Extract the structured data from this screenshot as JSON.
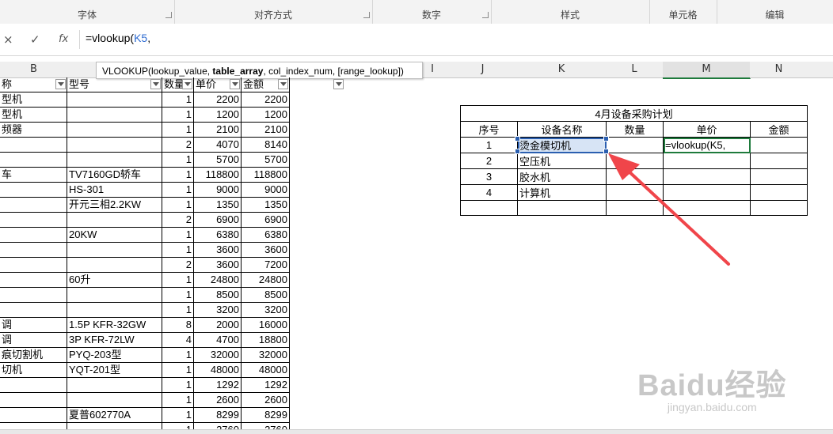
{
  "ribbon": {
    "groups": [
      "字体",
      "对齐方式",
      "数字",
      "样式",
      "单元格",
      "编辑"
    ]
  },
  "formula_bar": {
    "cancel_icon": "×",
    "enter_icon": "✓",
    "fx_icon": "fx",
    "formula_prefix": "=vlookup(",
    "formula_ref": "K5",
    "formula_suffix": ","
  },
  "tooltip": {
    "func": "VLOOKUP(lookup_value, ",
    "current_arg": "table_array",
    "rest": ", col_index_num, [range_lookup])"
  },
  "column_headers": {
    "B": "B",
    "I": "I",
    "J": "J",
    "K": "K",
    "L": "L",
    "M": "M",
    "N": "N"
  },
  "left_table": {
    "headers": [
      "称",
      "型号",
      "数量",
      "单价",
      "金额"
    ],
    "rows": [
      [
        "型机",
        "",
        "1",
        "2200",
        "2200"
      ],
      [
        "型机",
        "",
        "1",
        "1200",
        "1200"
      ],
      [
        "频器",
        "",
        "1",
        "2100",
        "2100"
      ],
      [
        "",
        "",
        "2",
        "4070",
        "8140"
      ],
      [
        "",
        "",
        "1",
        "5700",
        "5700"
      ],
      [
        "车",
        "TV7160GD轿车",
        "1",
        "118800",
        "118800"
      ],
      [
        "",
        "HS-301",
        "1",
        "9000",
        "9000"
      ],
      [
        "",
        "开元三相2.2KW",
        "1",
        "1350",
        "1350"
      ],
      [
        "",
        "",
        "2",
        "6900",
        "6900"
      ],
      [
        "",
        "20KW",
        "1",
        "6380",
        "6380"
      ],
      [
        "",
        "",
        "1",
        "3600",
        "3600"
      ],
      [
        "",
        "",
        "2",
        "3600",
        "7200"
      ],
      [
        "",
        "60升",
        "1",
        "24800",
        "24800"
      ],
      [
        "",
        "",
        "1",
        "8500",
        "8500"
      ],
      [
        "",
        "",
        "1",
        "3200",
        "3200"
      ],
      [
        "调",
        "1.5P KFR-32GW",
        "8",
        "2000",
        "16000"
      ],
      [
        "调",
        "3P KFR-72LW",
        "4",
        "4700",
        "18800"
      ],
      [
        "痕切割机",
        "PYQ-203型",
        "1",
        "32000",
        "32000"
      ],
      [
        "切机",
        "YQT-201型",
        "1",
        "48000",
        "48000"
      ],
      [
        "",
        "",
        "1",
        "1292",
        "1292"
      ],
      [
        "",
        "",
        "1",
        "2600",
        "2600"
      ],
      [
        "",
        "夏普602770A",
        "1",
        "8299",
        "8299"
      ],
      [
        "",
        "",
        "1",
        "2760",
        "2760"
      ]
    ]
  },
  "purchase_plan": {
    "title": "4月设备采购计划",
    "headers": [
      "序号",
      "设备名称",
      "数量",
      "单价",
      "金额"
    ],
    "rows": [
      [
        "1",
        "烫金模切机",
        "",
        "=vlookup(K5,",
        ""
      ],
      [
        "2",
        "空压机",
        "",
        "",
        ""
      ],
      [
        "3",
        "胶水机",
        "",
        "",
        ""
      ],
      [
        "4",
        "计算机",
        "",
        "",
        ""
      ]
    ]
  },
  "watermark": {
    "brand": "Baidu经验",
    "url": "jingyan.baidu.com"
  },
  "colors": {
    "selection": "#2b5fb0",
    "active_cell": "#1e7a3c",
    "arrow": "#f0454a",
    "formula_ref": "#2e6bd1"
  }
}
